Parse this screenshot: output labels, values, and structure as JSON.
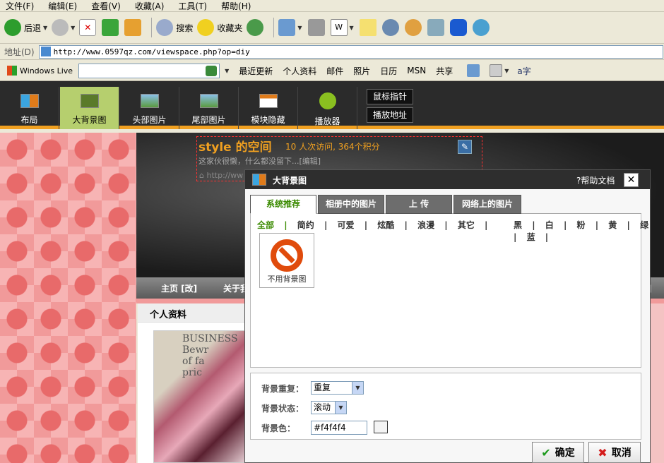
{
  "menu": [
    "文件(F)",
    "编辑(E)",
    "查看(V)",
    "收藏(A)",
    "工具(T)",
    "帮助(H)"
  ],
  "toolbar": {
    "back": "后退",
    "search": "搜索",
    "favorites": "收藏夹"
  },
  "address": {
    "label": "地址(D)",
    "url": "http://www.0597qz.com/viewspace.php?op=diy"
  },
  "linksbar": {
    "brand": "Windows Live",
    "links": [
      "最近更新",
      "个人资料",
      "邮件",
      "照片",
      "日历",
      "MSN",
      "共享"
    ]
  },
  "editor": {
    "tabs": [
      {
        "label": "布局"
      },
      {
        "label": "大背景图"
      },
      {
        "label": "头部图片"
      },
      {
        "label": "尾部图片"
      },
      {
        "label": "模块隐藏"
      },
      {
        "label": "播放器"
      }
    ],
    "buttons": [
      "鼠标指针",
      "播放地址"
    ]
  },
  "site": {
    "title": "style 的空间",
    "stats": "10 人次访问, 364个积分",
    "desc": "这家伙很懒，什么都没留下...[编辑]",
    "home_link": "http://ww",
    "nav_home": "主页 [改]",
    "nav_about": "关于我",
    "nav_right": "改]",
    "profile_title": "个人资料",
    "photo_text": "BUSINESS\nBewr\nof fa\npric"
  },
  "dialog": {
    "title": "大背景图",
    "help": "?帮助文档",
    "tabs": [
      "系统推荐",
      "相册中的图片",
      "上  传",
      "网络上的图片"
    ],
    "categories": [
      "全部",
      "简约",
      "可爱",
      "炫酷",
      "浪漫",
      "其它"
    ],
    "colors": [
      "黑",
      "白",
      "粉",
      "黄",
      "绿",
      "蓝"
    ],
    "nobg_label": "不用背景图",
    "repeat_label": "背景重复：",
    "repeat_value": "重复",
    "state_label": "背景状态：",
    "state_value": "滚动",
    "color_label": "背景色：",
    "color_value": "#f4f4f4",
    "ok": "确定",
    "cancel": "取消"
  }
}
